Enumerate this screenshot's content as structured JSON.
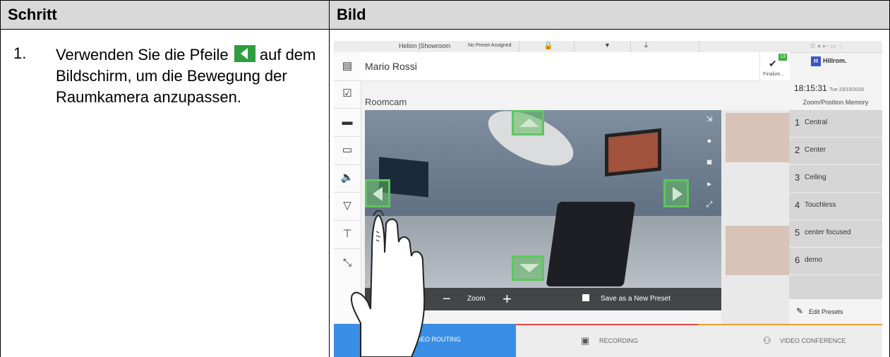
{
  "table": {
    "col_step": "Schritt",
    "col_image": "Bild",
    "step_number": "1.",
    "step_text_before": "Verwenden Sie die Pfeile",
    "step_text_after": "auf dem Bildschirm, um die Bewegung der Raumkamera anzupassen."
  },
  "app": {
    "topbar": {
      "location": "Helion |Showroom",
      "preset_status": "No Preset Assigned"
    },
    "patient_name": "Mario Rossi",
    "finalize_label": "Finalize...",
    "finalize_badge": "13",
    "brand": "Hillrom.",
    "brand_mark": "H",
    "clock": "18:15:31",
    "date": "Tue 23/10/2018",
    "zoom_position_title": "Zoom/Position Memory",
    "camera_title": "Roomcam",
    "zoom_label": "Zoom",
    "zoom_minus": "−",
    "zoom_plus": "+",
    "save_preset_label": "Save as a New Preset",
    "presets": [
      {
        "num": "1",
        "label": "Central"
      },
      {
        "num": "2",
        "label": "Center"
      },
      {
        "num": "3",
        "label": "Ceiling"
      },
      {
        "num": "4",
        "label": "Touchless"
      },
      {
        "num": "5",
        "label": "center focused"
      },
      {
        "num": "6",
        "label": "demo"
      }
    ],
    "edit_presets_label": "Edit Presets",
    "tabs": [
      {
        "label": "VIDEO ROUTING",
        "color": "#3a8ee6"
      },
      {
        "label": "RECORDING",
        "color": "#e14b4b"
      },
      {
        "label": "VIDEO CONFERENCE",
        "color": "#f0a030"
      }
    ]
  }
}
